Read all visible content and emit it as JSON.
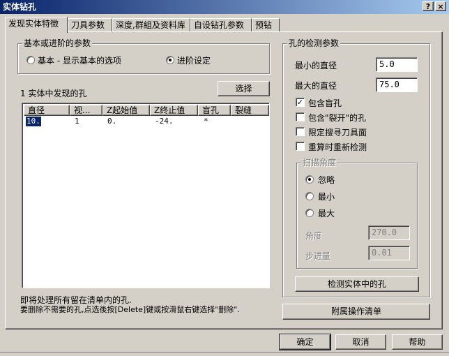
{
  "window": {
    "title": "实体钻孔",
    "help_glyph": "?",
    "close_glyph": "×"
  },
  "tabs": [
    {
      "label": "发现实体特徵"
    },
    {
      "label": "刀具参数"
    },
    {
      "label": "深度,群組及资料库"
    },
    {
      "label": "自设钻孔参数"
    },
    {
      "label": "预钻"
    }
  ],
  "basic_advanced": {
    "group_label": "基本或进阶的参数",
    "basic_label": "基本 - 显示基本的选项",
    "advanced_label": "进阶设定",
    "selected": "advanced"
  },
  "holes": {
    "count_label": "1 实体中发现的孔",
    "select_button": "选择",
    "columns": [
      "直径",
      "视...",
      "Z起始值",
      "Z终止值",
      "盲孔",
      "裂缝"
    ],
    "rows": [
      [
        "10.",
        "1",
        "0.",
        "-24.",
        "*",
        ""
      ]
    ],
    "info_line1": "即将处理所有留在清单内的孔.",
    "info_line2": "要删除不需要的孔,点选後按[Delete]键或按滑鼠右键选择\"删除\"."
  },
  "detection": {
    "group_label": "孔的检测参数",
    "min_label": "最小的直径",
    "min_value": "5.0",
    "max_label": "最大的直径",
    "max_value": "75.0",
    "checks": [
      {
        "label": "包含盲孔",
        "checked": true
      },
      {
        "label": "包含\"裂开\"的孔",
        "checked": false
      },
      {
        "label": "限定搜寻刀具面",
        "checked": false
      },
      {
        "label": "重算时重新检测",
        "checked": false
      }
    ],
    "scan": {
      "group_label": "扫描角度",
      "ignore_label": "忽略",
      "min_label": "最小",
      "max_label": "最大",
      "selected": "ignore",
      "angle_label": "角度",
      "angle_value": "270.0",
      "step_label": "步进量",
      "step_value": "0.01"
    },
    "detect_button": "检测实体中的孔"
  },
  "attach_button": "附属操作清单",
  "footer": {
    "ok": "确定",
    "cancel": "取消",
    "help": "帮助"
  }
}
